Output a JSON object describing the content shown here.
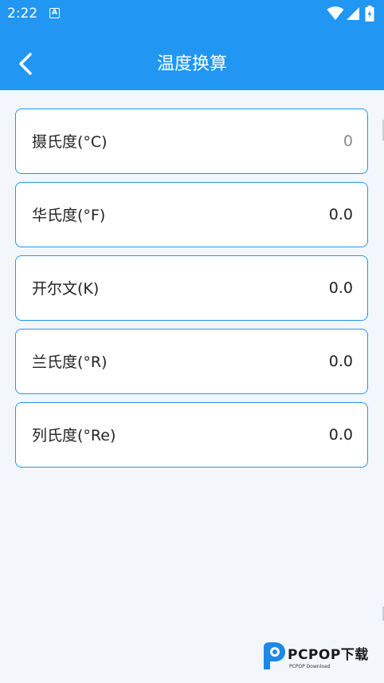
{
  "status_bar": {
    "time": "2:22",
    "notification_icon": "A"
  },
  "header": {
    "title": "温度换算",
    "back_icon": "chevron-left-icon"
  },
  "conversions": [
    {
      "label": "摄氏度(°C)",
      "value": "",
      "placeholder": "0"
    },
    {
      "label": "华氏度(°F)",
      "value": "0.0",
      "placeholder": ""
    },
    {
      "label": "开尔文(K)",
      "value": "0.0",
      "placeholder": ""
    },
    {
      "label": "兰氏度(°R)",
      "value": "0.0",
      "placeholder": ""
    },
    {
      "label": "列氏度(°Re)",
      "value": "0.0",
      "placeholder": ""
    }
  ],
  "watermark": {
    "brand": "PCPOP下载",
    "sub": "PCPOP Download"
  },
  "colors": {
    "primary": "#2196f3",
    "background": "#f3f7fc",
    "card": "#ffffff"
  }
}
